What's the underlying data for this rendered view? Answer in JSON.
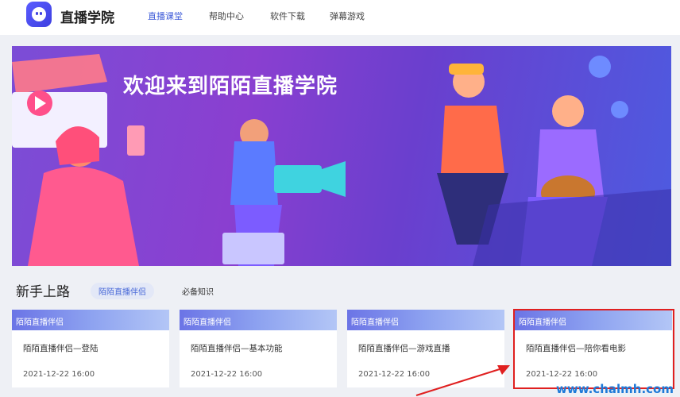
{
  "header": {
    "brand": "直播学院",
    "nav": [
      "直播课堂",
      "帮助中心",
      "软件下载",
      "弹幕游戏"
    ],
    "active_nav": "直播课堂"
  },
  "banner": {
    "title": "欢迎来到陌陌直播学院"
  },
  "section": {
    "title": "新手上路",
    "tabs": [
      "陌陌直播伴侣",
      "必备知识"
    ],
    "active_tab": "陌陌直播伴侣"
  },
  "cards": [
    {
      "category": "陌陌直播伴侣",
      "title": "陌陌直播伴侣—登陆",
      "date": "2021-12-22 16:00"
    },
    {
      "category": "陌陌直播伴侣",
      "title": "陌陌直播伴侣—基本功能",
      "date": "2021-12-22 16:00"
    },
    {
      "category": "陌陌直播伴侣",
      "title": "陌陌直播伴侣—游戏直播",
      "date": "2021-12-22 16:00"
    },
    {
      "category": "陌陌直播伴侣",
      "title": "陌陌直播伴侣—陪你看电影",
      "date": "2021-12-22 16:00"
    }
  ],
  "watermark": "www.chalmh.com",
  "colors": {
    "accent": "#3e5bd8",
    "highlight": "#e02020"
  }
}
